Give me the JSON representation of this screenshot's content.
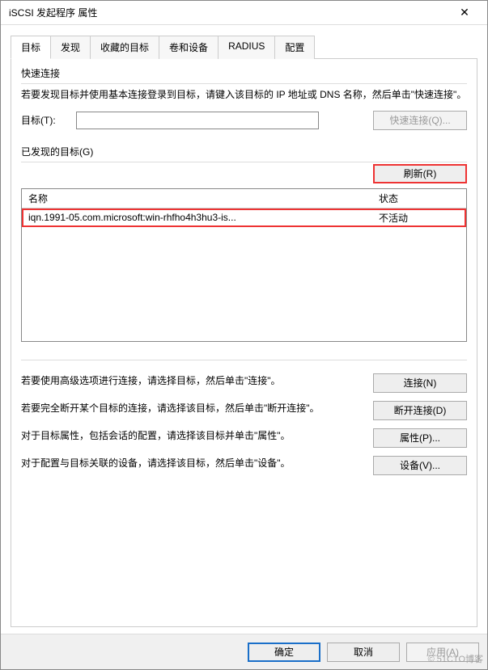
{
  "window": {
    "title": "iSCSI 发起程序 属性",
    "close_icon": "✕"
  },
  "tabs": [
    {
      "label": "目标",
      "active": true
    },
    {
      "label": "发现"
    },
    {
      "label": "收藏的目标"
    },
    {
      "label": "卷和设备"
    },
    {
      "label": "RADIUS"
    },
    {
      "label": "配置"
    }
  ],
  "quick_connect": {
    "title": "快速连接",
    "desc": "若要发现目标并使用基本连接登录到目标，请键入该目标的 IP 地址或 DNS 名称，然后单击\"快速连接\"。",
    "target_label": "目标(T):",
    "target_value": "",
    "button": "快速连接(Q)..."
  },
  "discovered": {
    "title": "已发现的目标(G)",
    "refresh_button": "刷新(R)",
    "columns": {
      "name": "名称",
      "state": "状态"
    },
    "rows": [
      {
        "name": "iqn.1991-05.com.microsoft:win-rhfho4h3hu3-is...",
        "state": "不活动"
      }
    ]
  },
  "actions": {
    "connect_desc": "若要使用高级选项进行连接，请选择目标，然后单击\"连接\"。",
    "connect_button": "连接(N)",
    "disconnect_desc": "若要完全断开某个目标的连接，请选择该目标，然后单击\"断开连接\"。",
    "disconnect_button": "断开连接(D)",
    "props_desc": "对于目标属性，包括会话的配置，请选择该目标并单击\"属性\"。",
    "props_button": "属性(P)...",
    "devices_desc": "对于配置与目标关联的设备，请选择该目标，然后单击\"设备\"。",
    "devices_button": "设备(V)..."
  },
  "buttons": {
    "ok": "确定",
    "cancel": "取消",
    "apply": "应用(A)"
  },
  "watermark": "© 51CTO博客"
}
